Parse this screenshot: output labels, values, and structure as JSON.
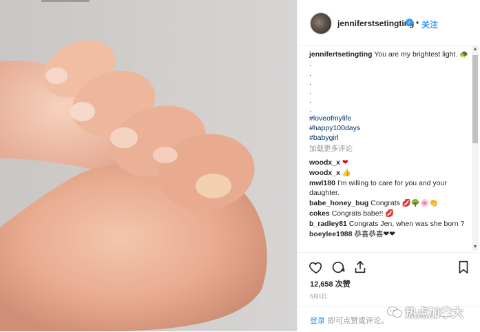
{
  "post": {
    "username": "jenniferstsetingting",
    "follow_label": "关注",
    "caption_user": "jennifertsetingting",
    "caption_text": " You are my brightest light. 🐢 .",
    "caption_dots": [
      ".",
      ".",
      ".",
      ".",
      "."
    ],
    "hashtags": [
      "#loveofmylife",
      "#happy100days",
      "#babygirl"
    ],
    "load_more": "加载更多评论",
    "comments": [
      {
        "user": "woodx_x",
        "text": " ❤"
      },
      {
        "user": "woodx_x",
        "text": " 👍"
      },
      {
        "user": "mwl180",
        "text": " I'm willing to care for you and your daughter."
      },
      {
        "user": "babe_honey_bug",
        "text": " Congrats 💋🌳🌸👏"
      },
      {
        "user": "cokes",
        "text": " Congrats babe!! 💋"
      },
      {
        "user": "b_radley81",
        "text": " Congrats Jen, when was she born ?"
      },
      {
        "user": "boeylee1988",
        "text": " 恭喜恭喜❤❤"
      }
    ],
    "likes": "12,658 次赞",
    "date": "6月1日",
    "login_label": "登录",
    "login_text": "即可点赞或评论。"
  },
  "watermark": "热点加拿大",
  "icons": [
    "heart-icon",
    "comment-icon",
    "share-icon",
    "bookmark-icon",
    "verified-icon",
    "wechat-icon"
  ]
}
